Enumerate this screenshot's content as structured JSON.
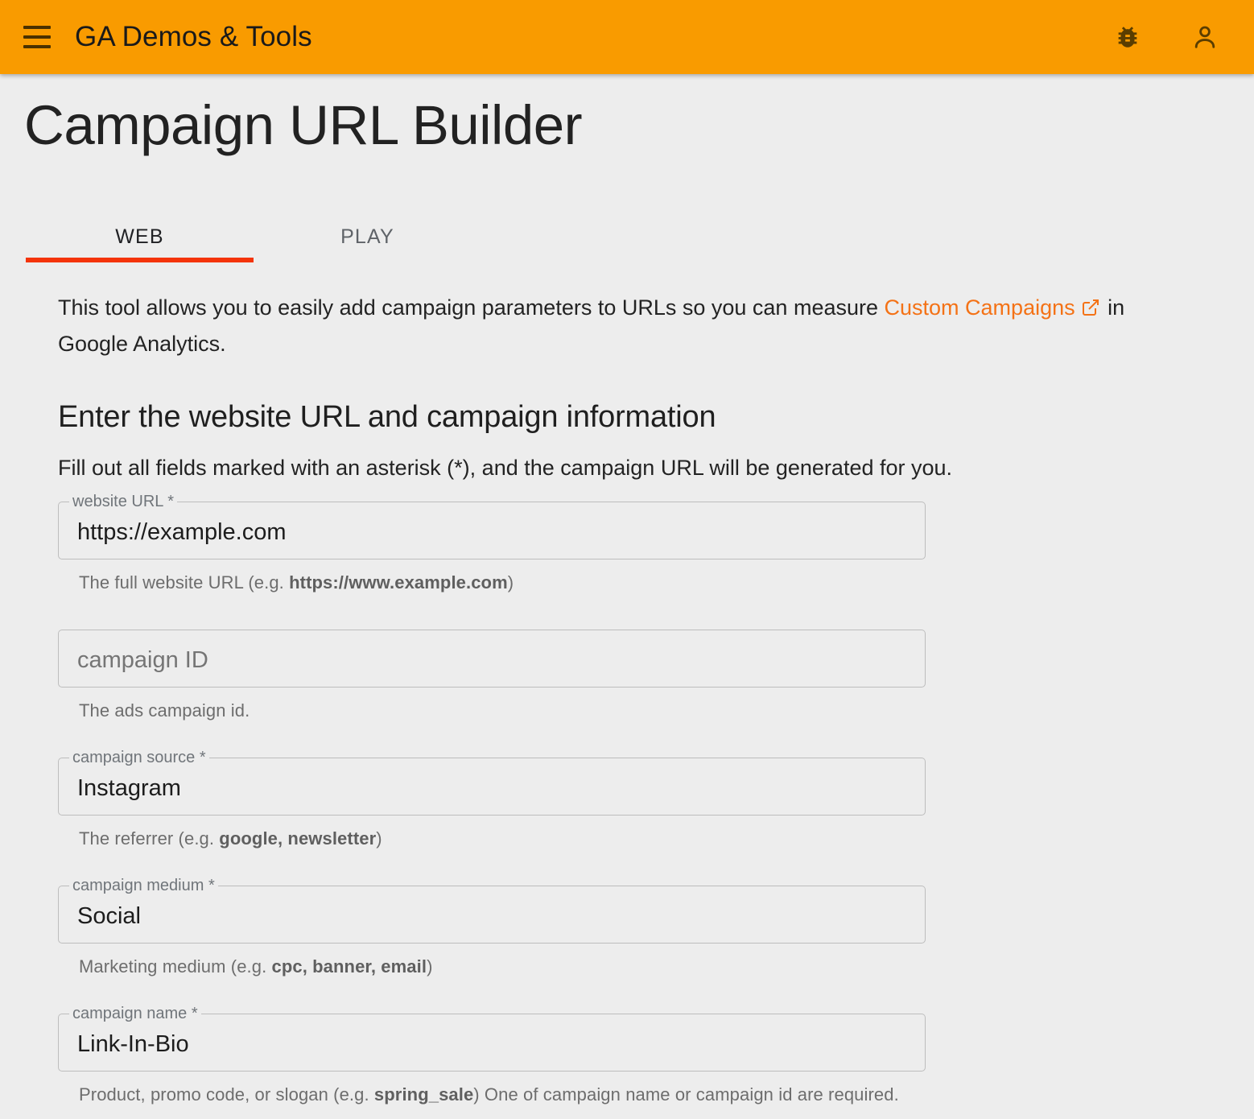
{
  "appbar": {
    "menu_icon": "hamburger-menu-icon",
    "title": "GA Demos & Tools",
    "bug_icon": "bug-report-icon",
    "account_icon": "account-person-icon"
  },
  "page": {
    "title": "Campaign URL Builder"
  },
  "tabs": [
    {
      "label": "WEB",
      "active": true
    },
    {
      "label": "PLAY",
      "active": false
    }
  ],
  "intro": {
    "before_link": "This tool allows you to easily add campaign parameters to URLs so you can measure ",
    "link_text": "Custom Campaigns",
    "link_icon": "open-in-new-icon",
    "after_link": " in Google Analytics."
  },
  "section": {
    "heading": "Enter the website URL and campaign information",
    "subheading": "Fill out all fields marked with an asterisk (*), and the campaign URL will be generated for you."
  },
  "fields": [
    {
      "name": "website-url",
      "label": "website URL *",
      "placeholder": "website URL *",
      "value": "https://example.com",
      "has_value": true,
      "hint_prefix": "The full website URL (e.g. ",
      "hint_bold": "https://www.example.com",
      "hint_suffix": ")"
    },
    {
      "name": "campaign-id",
      "label": "campaign ID",
      "placeholder": "campaign ID",
      "value": "",
      "has_value": false,
      "hint_prefix": "The ads campaign id.",
      "hint_bold": "",
      "hint_suffix": ""
    },
    {
      "name": "campaign-source",
      "label": "campaign source *",
      "placeholder": "campaign source *",
      "value": "Instagram",
      "has_value": true,
      "hint_prefix": "The referrer (e.g. ",
      "hint_bold": "google, newsletter",
      "hint_suffix": ")"
    },
    {
      "name": "campaign-medium",
      "label": "campaign medium *",
      "placeholder": "campaign medium *",
      "value": "Social",
      "has_value": true,
      "hint_prefix": "Marketing medium (e.g. ",
      "hint_bold": "cpc, banner, email",
      "hint_suffix": ")"
    },
    {
      "name": "campaign-name",
      "label": "campaign name *",
      "placeholder": "campaign name *",
      "value": "Link-In-Bio",
      "has_value": true,
      "hint_prefix": "Product, promo code, or slogan (e.g. ",
      "hint_bold": "spring_sale",
      "hint_suffix": ") One of campaign name or campaign id are required."
    }
  ],
  "colors": {
    "appbar": "#f99b00",
    "tab_indicator": "#f4340a",
    "link": "#f47216",
    "background": "#ededed",
    "field_border": "#bdbdbd"
  }
}
